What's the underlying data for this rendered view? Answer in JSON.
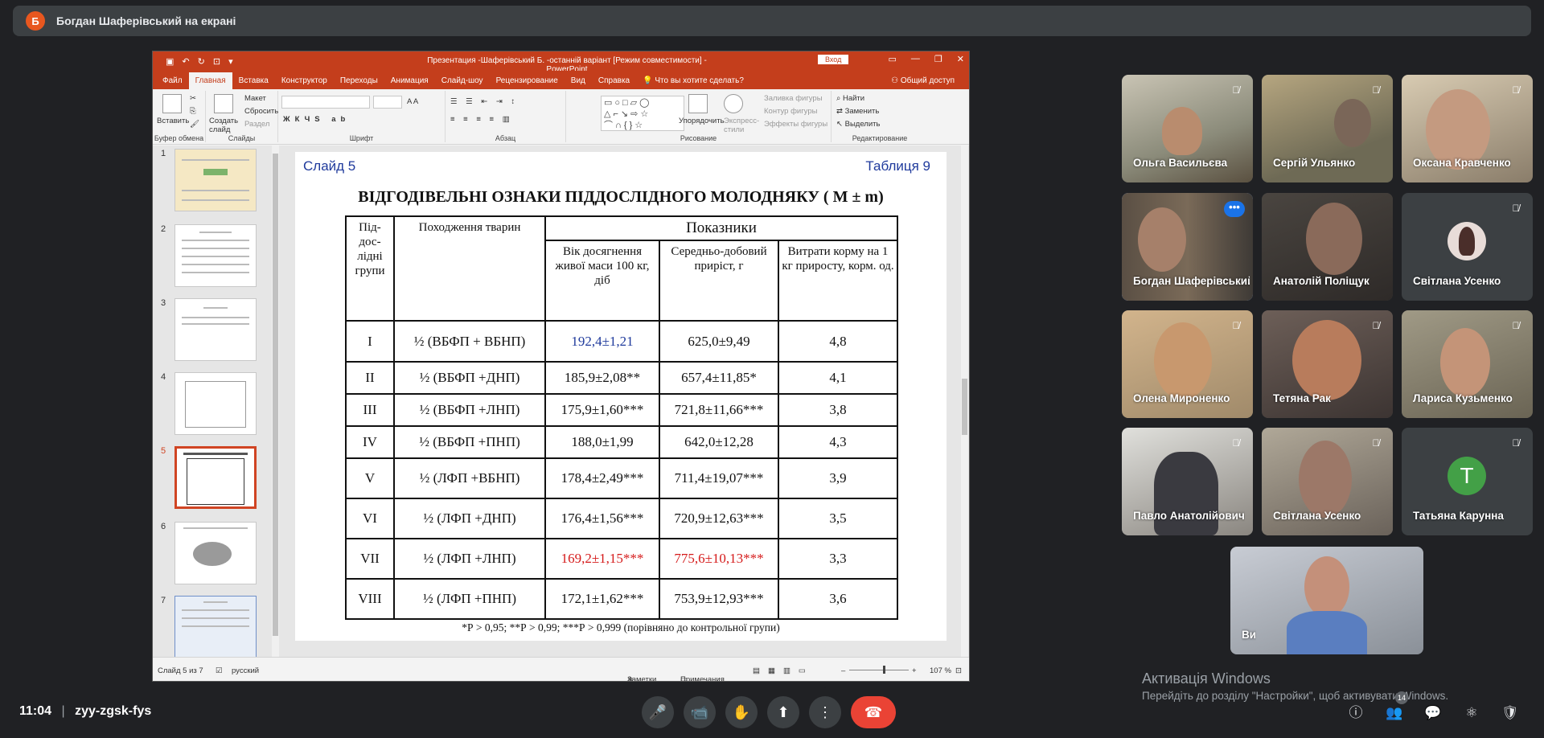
{
  "banner": {
    "avatar_letter": "Б",
    "text": "Богдан Шаферівський на екрані"
  },
  "ppt": {
    "title": "Презентация -Шаферівський Б. -останній варіант [Режим совместимости]  -  PowerPoint",
    "signin": "Вход",
    "tabs": [
      "Файл",
      "Главная",
      "Вставка",
      "Конструктор",
      "Переходы",
      "Анимация",
      "Слайд-шоу",
      "Рецензирование",
      "Вид",
      "Справка",
      "Что вы хотите сделать?"
    ],
    "share": "Общий доступ",
    "ribbon": {
      "paste": "Вставить",
      "create_slide": "Создать слайд",
      "layout": "Макет",
      "reset": "Сбросить",
      "section": "Раздел",
      "arrange": "Упорядочить",
      "quick_styles": "Экспресс-стили",
      "shape_fill": "Заливка фигуры",
      "shape_outline": "Контур фигуры",
      "shape_effects": "Эффекты фигуры",
      "find": "Найти",
      "replace": "Заменить",
      "select": "Выделить",
      "groups": [
        "Буфер обмена",
        "Слайды",
        "Шрифт",
        "Абзац",
        "Рисование",
        "Редактирование"
      ]
    },
    "thumb_numbers": [
      "1",
      "2",
      "3",
      "4",
      "5",
      "6",
      "7"
    ],
    "slide": {
      "num": "Слайд 5",
      "table_label": "Таблиця 9",
      "heading": "ВІДГОДІВЕЛЬНІ ОЗНАКИ ПІДДОСЛІДНОГО МОЛОДНЯКУ ( М ±  m)",
      "col_group": "Під-дос-лідні групи",
      "col_origin": "Походження тварин",
      "col_indicators": "Показники",
      "col_age": "Вік досягнення живої маси 100 кг, діб",
      "col_gain": "Середньо-добовий приріст, г",
      "col_feed": "Витрати корму на 1 кг приросту, корм. од.",
      "rows": [
        {
          "group": "I",
          "origin": "½ (ВБФП + ВБНП)",
          "age": "192,4±1,21",
          "gain": "625,0±9,49",
          "feed": "4,8"
        },
        {
          "group": "II",
          "origin": "½ (ВБФП +ДНП)",
          "age": "185,9±2,08**",
          "gain": "657,4±11,85*",
          "feed": "4,1"
        },
        {
          "group": "III",
          "origin": "½ (ВБФП +ЛНП)",
          "age": "175,9±1,60***",
          "gain": "721,8±11,66***",
          "feed": "3,8"
        },
        {
          "group": "IV",
          "origin": "½ (ВБФП +ПНП)",
          "age": "188,0±1,99",
          "gain": "642,0±12,28",
          "feed": "4,3"
        },
        {
          "group": "V",
          "origin": "½ (ЛФП +ВБНП)",
          "age": "178,4±2,49***",
          "gain": "711,4±19,07***",
          "feed": "3,9"
        },
        {
          "group": "VI",
          "origin": "½ (ЛФП +ДНП)",
          "age": "176,4±1,56***",
          "gain": "720,9±12,63***",
          "feed": "3,5"
        },
        {
          "group": "VII",
          "origin": "½ (ЛФП +ЛНП)",
          "age": "169,2±1,15***",
          "gain": "775,6±10,13***",
          "feed": "3,3"
        },
        {
          "group": "VIII",
          "origin": "½ (ЛФП +ПНП)",
          "age": "172,1±1,62***",
          "gain": "753,9±12,93***",
          "feed": "3,6"
        }
      ],
      "note": "*Р > 0,95; **Р > 0,99; ***Р > 0,999 (порівняно до контрольної групи)"
    },
    "status": {
      "slide": "Слайд 5 из 7",
      "lang": "русский",
      "notes": "Заметки",
      "comments": "Примечания",
      "zoom": "107 %"
    }
  },
  "participants": [
    {
      "name": "Ольга Васильєва",
      "bg": "#8b8b7a"
    },
    {
      "name": "Сергій Ульянко",
      "bg": "#6e6a55"
    },
    {
      "name": "Оксана Кравченко",
      "bg": "#8a7d6a"
    },
    {
      "name": "Богдан Шаферівський",
      "bg": "#5a4f44"
    },
    {
      "name": "Анатолій Поліщук",
      "bg": "#4a4540"
    },
    {
      "name": "Світлана Усенко",
      "initial": "",
      "bg": "#3c4043"
    },
    {
      "name": "Олена Мироненко",
      "bg": "#a08a6a"
    },
    {
      "name": "Тетяна Рак",
      "bg": "#5d5450"
    },
    {
      "name": "Лариса Кузьменко",
      "bg": "#7a7260"
    },
    {
      "name": "Павло Анатолійович",
      "bg": "#6a6560"
    },
    {
      "name": "Світлана Усенко",
      "bg": "#7d746a"
    },
    {
      "name": "Татьяна Карунна",
      "initial": "Т",
      "bg": "#3c4043",
      "avatar_color": "#43a047"
    },
    {
      "name": "Ви",
      "bg": "#8a9098"
    }
  ],
  "watermark": {
    "line1": "Активація Windows",
    "line2": "Перейдіть до розділу \"Настройки\", щоб активувати Windows.",
    "people_count": "14"
  },
  "bottom": {
    "time": "11:04",
    "separator": "|",
    "code": "zyy-zgsk-fys"
  }
}
